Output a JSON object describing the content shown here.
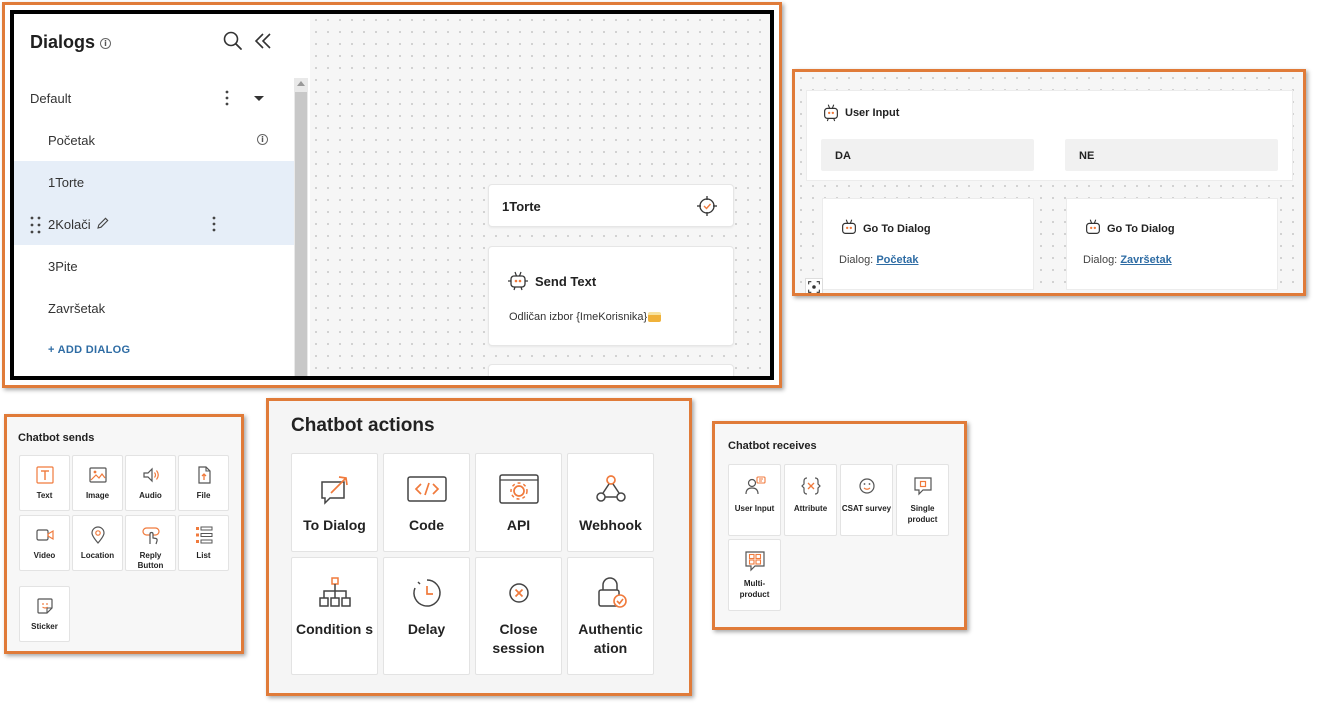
{
  "dialogs": {
    "title": "Dialogs",
    "info_glyph": "i",
    "groups": [
      {
        "label": "Default"
      }
    ],
    "items": [
      {
        "label": "Početak"
      },
      {
        "label": "1Torte"
      },
      {
        "label": "2Kolači"
      },
      {
        "label": "3Pite"
      },
      {
        "label": "Završetak"
      }
    ],
    "add_label": "+ ADD DIALOG"
  },
  "canvas": {
    "dialog_card": {
      "title": "1Torte"
    },
    "send_text_card": {
      "title": "Send Text",
      "body": "Odličan izbor {ImeKorisnika}"
    }
  },
  "user_input": {
    "title": "User Input",
    "options": [
      "DA",
      "NE"
    ],
    "goto_cards": [
      {
        "title": "Go To Dialog",
        "prefix": "Dialog:",
        "target": "Početak"
      },
      {
        "title": "Go To Dialog",
        "prefix": "Dialog:",
        "target": "Završetak"
      }
    ]
  },
  "chatbot_sends": {
    "title": "Chatbot sends",
    "items": [
      {
        "label": "Text",
        "icon": "text-icon"
      },
      {
        "label": "Image",
        "icon": "image-icon"
      },
      {
        "label": "Audio",
        "icon": "audio-icon"
      },
      {
        "label": "File",
        "icon": "file-icon"
      },
      {
        "label": "Video",
        "icon": "video-icon"
      },
      {
        "label": "Location",
        "icon": "location-icon"
      },
      {
        "label": "Reply Button",
        "icon": "reply-button-icon"
      },
      {
        "label": "List",
        "icon": "list-icon"
      },
      {
        "label": "Sticker",
        "icon": "sticker-icon"
      }
    ]
  },
  "chatbot_actions": {
    "title": "Chatbot actions",
    "items": [
      {
        "label": "To Dialog",
        "icon": "to-dialog-icon"
      },
      {
        "label": "Code",
        "icon": "code-icon"
      },
      {
        "label": "API",
        "icon": "api-icon"
      },
      {
        "label": "Webhook",
        "icon": "webhook-icon"
      },
      {
        "label": "Condition s",
        "icon": "conditions-icon"
      },
      {
        "label": "Delay",
        "icon": "delay-icon"
      },
      {
        "label": "Close session",
        "icon": "close-session-icon"
      },
      {
        "label": "Authentic ation",
        "icon": "authentication-icon"
      }
    ]
  },
  "chatbot_receives": {
    "title": "Chatbot receives",
    "items": [
      {
        "label": "User Input",
        "icon": "user-input-icon"
      },
      {
        "label": "Attribute",
        "icon": "attribute-icon"
      },
      {
        "label": "CSAT survey",
        "icon": "csat-icon"
      },
      {
        "label": "Single product",
        "icon": "single-product-icon"
      },
      {
        "label": "Multi- product",
        "icon": "multi-product-icon"
      }
    ]
  },
  "colors": {
    "accent": "#e07b39",
    "icon": "#f07a3c",
    "link": "#2e6ca4",
    "selected_row": "#e6eef8"
  }
}
